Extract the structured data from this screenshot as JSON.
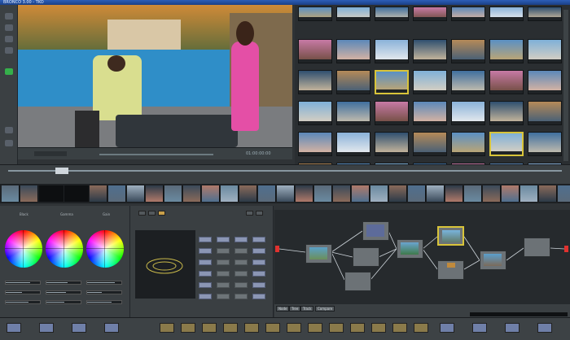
{
  "window": {
    "title": "BRONCO 3.00 - TKO"
  },
  "viewer": {
    "timecode": "01:00:00:00"
  },
  "color_panel": {
    "wheel_labels": [
      "Black",
      "Gamma",
      "Gain"
    ]
  },
  "node_tabs": [
    "Node",
    "Tree",
    "Track",
    "Compare"
  ]
}
